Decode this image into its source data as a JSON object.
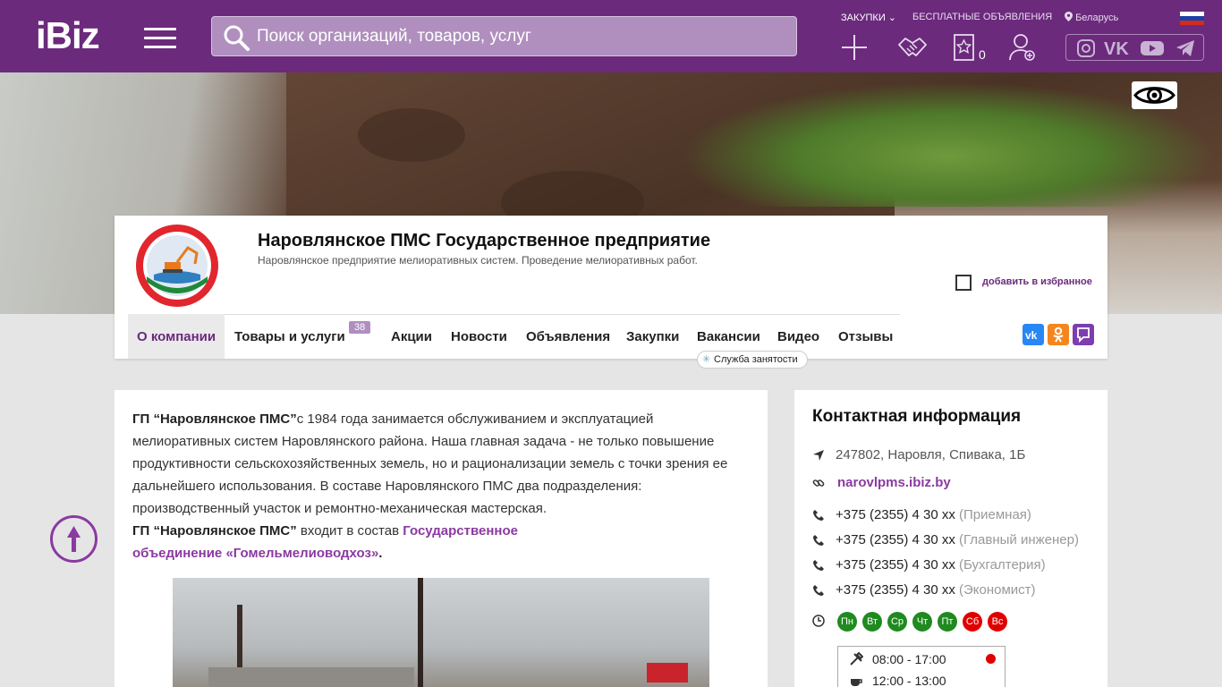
{
  "header": {
    "logo": "iBiz",
    "search_placeholder": "Поиск организаций, товаров, услуг",
    "nav_procurement": "ЗАКУПКИ",
    "nav_ads": "БЕСПЛАТНЫЕ ОБЪЯВЛЕНИЯ",
    "nav_region": "Беларусь",
    "favorites_count": "0"
  },
  "company": {
    "title": "Наровлянское ПМС Государственное предприятие",
    "subtitle": "Наровлянское предприятие мелиоративных систем. Проведение мелиоративных работ.",
    "favorite_label": "добавить в избранное"
  },
  "tabs": {
    "about": "О компании",
    "goods": "Товары и услуги",
    "goods_count": "38",
    "promos": "Акции",
    "news": "Новости",
    "ads": "Объявления",
    "procurement": "Закупки",
    "vacancies": "Вакансии",
    "video": "Видео",
    "reviews": "Отзывы",
    "job_tag": "Служба занятости"
  },
  "about": {
    "p1_bold": "ГП “Наровлянское ПМС”",
    "p1_l1": "с 1984 года занимается обслуживанием и эксплуатацией",
    "p1_l2": "мелиоративных систем Наровлянского района. Наша главная задача - не только повышение",
    "p1_l3": "продуктивности сельскохозяйственных земель, но и рационализации земель с точки зрения ее",
    "p1_l4": "дальнейшего использования. В составе Наровлянского ПМС два подразделения:",
    "p1_l5": "производственный участок и ремонтно-механическая мастерская.",
    "p2_bold": "ГП “Наровлянское ПМС”",
    "p2_text": " входит в состав ",
    "p2_link_l1": "Государственное",
    "p2_link_l2": "объединение «Гомельмелиоводхоз»",
    "p2_end": "."
  },
  "contacts": {
    "title": "Контактная информация",
    "address": "247802, Наровля, Спивака, 1Б",
    "site": "narovlpms.ibiz.by",
    "phones": [
      {
        "number": "+375 (2355) 4 30 xx",
        "note": "(Приемная)"
      },
      {
        "number": "+375 (2355) 4 30 xx",
        "note": "(Главный инженер)"
      },
      {
        "number": "+375 (2355) 4 30 xx",
        "note": "(Бухгалтерия)"
      },
      {
        "number": "+375 (2355) 4 30 xx",
        "note": "(Экономист)"
      }
    ],
    "days": [
      "Пн",
      "Вт",
      "Ср",
      "Чт",
      "Пт",
      "Сб",
      "Вс"
    ],
    "work_hours": "08:00 - 17:00",
    "break_hours": "12:00 - 13:00"
  },
  "colors": {
    "brand": "#6b2a7c",
    "workday": "#1f8a1f",
    "weekend": "#e00000"
  }
}
